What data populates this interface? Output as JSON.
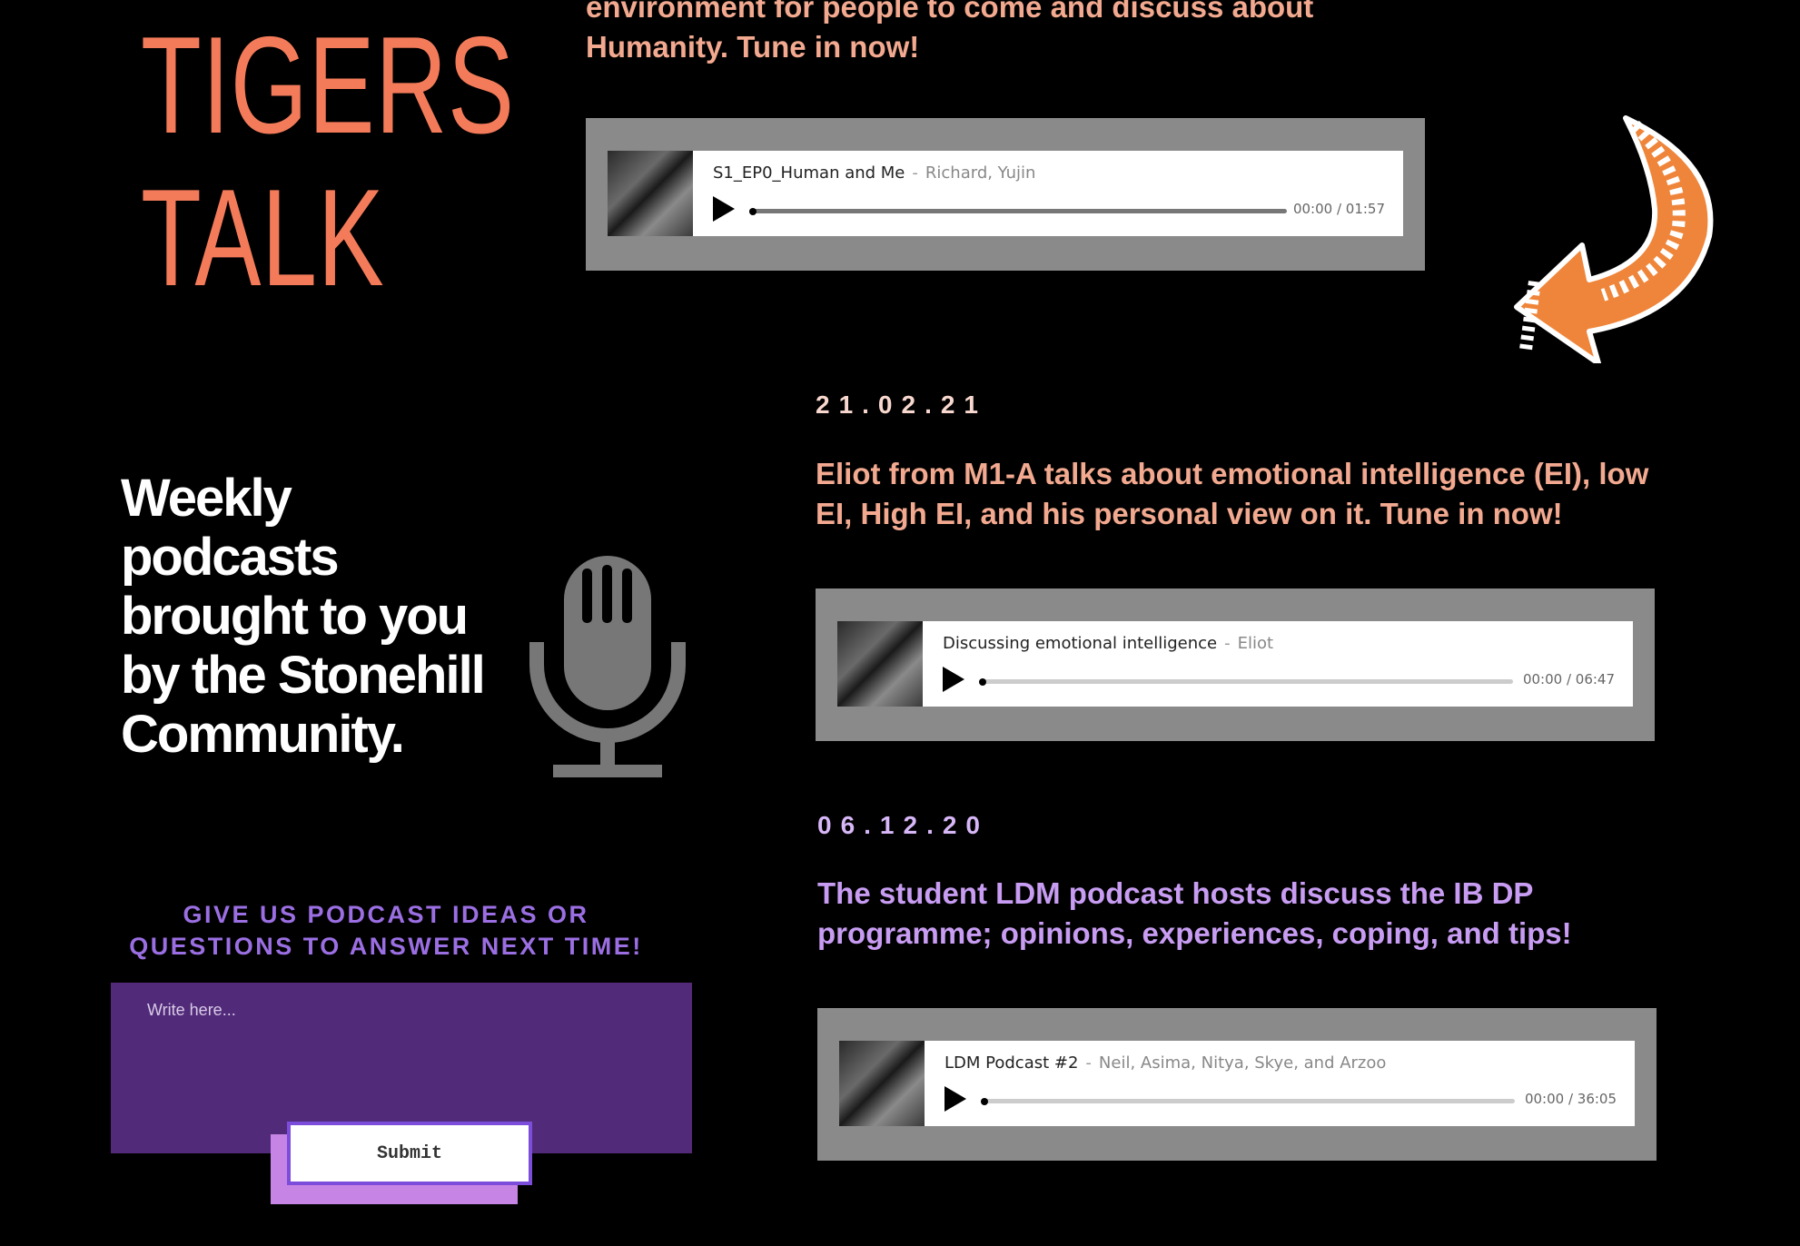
{
  "brand": {
    "line1": "TIGERS",
    "line2": "TALK"
  },
  "tagline": "Weekly podcasts brought to you by the Stonehill Community.",
  "intro_text": "environment for people to come and discuss about Humanity. Tune in now!",
  "episodes": [
    {
      "player": {
        "title": "S1_EP0_Human and Me",
        "separator": "-",
        "artist": "Richard, Yujin",
        "time": "00:00 / 01:57",
        "progress": 0
      }
    },
    {
      "date": "21.02.21",
      "description": "Eliot from M1-A talks about emotional intelligence (EI), low EI, High EI, and his personal view on it. Tune in now!",
      "player": {
        "title": "Discussing emotional intelligence",
        "separator": "-",
        "artist": "Eliot",
        "time": "00:00 / 06:47",
        "progress": 0
      }
    },
    {
      "date": "06.12.20",
      "description": "The student LDM podcast hosts discuss the IB DP programme; opinions, experiences, coping, and tips!",
      "player": {
        "title": "LDM Podcast #2",
        "separator": "-",
        "artist": "Neil, Asima, Nitya, Skye, and Arzoo",
        "time": "00:00 / 36:05",
        "progress": 0
      }
    }
  ],
  "ideas": {
    "heading_line1": "GIVE US PODCAST IDEAS OR",
    "heading_line2": "QUESTIONS TO ANSWER NEXT TIME!",
    "placeholder": "Write here...",
    "submit_label": "Submit"
  },
  "colors": {
    "background": "#000000",
    "brand": "#f47b5a",
    "accent_purple": "#9b6fe3",
    "form_bg": "#522a7a",
    "arrow_orange": "#ef853a",
    "mic_gray": "#777777"
  },
  "icons": [
    "microphone-icon",
    "curved-arrow-icon",
    "play-icon"
  ]
}
